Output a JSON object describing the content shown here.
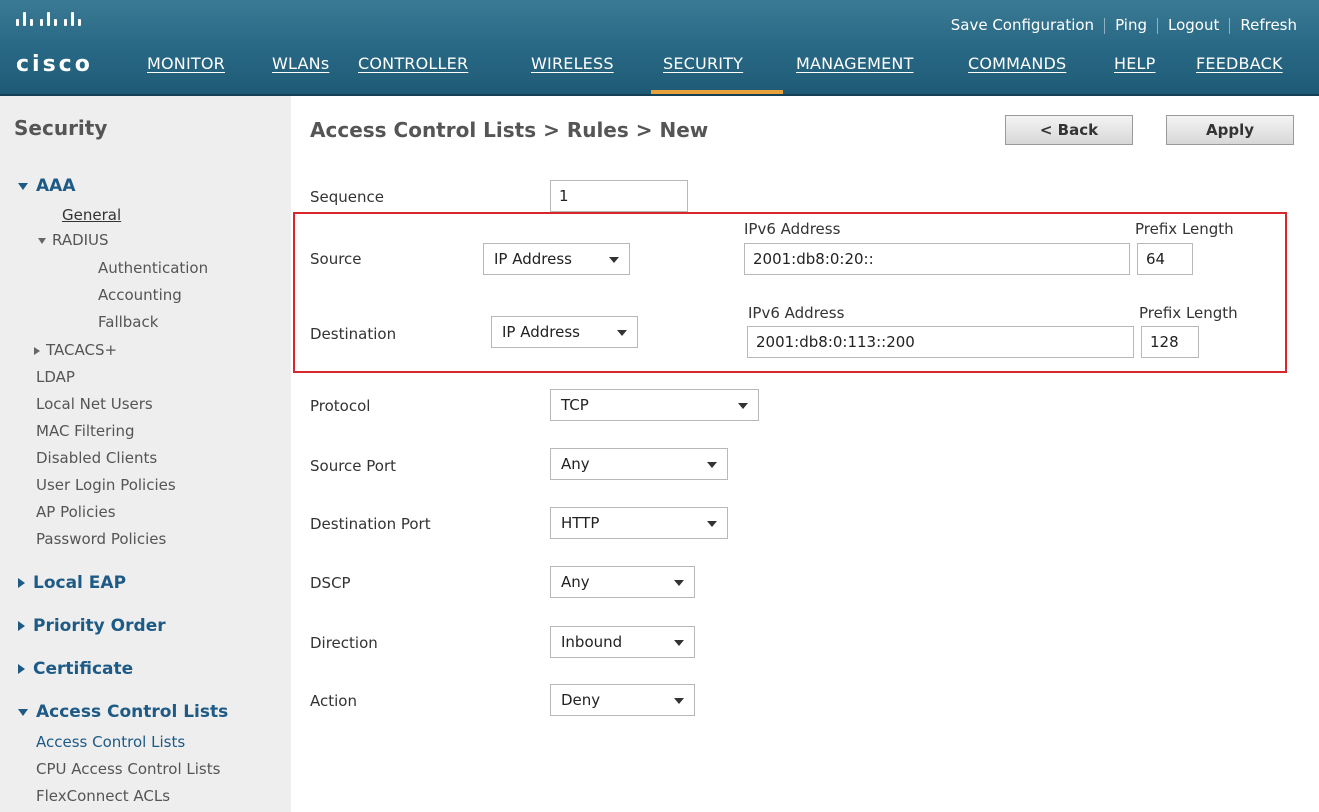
{
  "header": {
    "logo": "cisco",
    "util_links": [
      "Save Configuration",
      "Ping",
      "Logout",
      "Refresh"
    ],
    "nav": [
      "MONITOR",
      "WLANs",
      "CONTROLLER",
      "WIRELESS",
      "SECURITY",
      "MANAGEMENT",
      "COMMANDS",
      "HELP",
      "FEEDBACK"
    ],
    "active_nav": "SECURITY",
    "accent": "#e7a23c"
  },
  "sidebar": {
    "title": "Security",
    "aaa": "AAA",
    "general": "General",
    "radius": "RADIUS",
    "authentication": "Authentication",
    "accounting": "Accounting",
    "fallback": "Fallback",
    "tacacs": "TACACS+",
    "ldap": "LDAP",
    "local_net_users": "Local Net Users",
    "mac_filtering": "MAC Filtering",
    "disabled_clients": "Disabled Clients",
    "user_login_policies": "User Login Policies",
    "ap_policies": "AP Policies",
    "password_policies": "Password Policies",
    "local_eap": "Local EAP",
    "priority_order": "Priority Order",
    "certificate": "Certificate",
    "acl": "Access Control Lists",
    "acl_sub": "Access Control Lists",
    "cpu_acl": "CPU Access Control Lists",
    "flexconnect": "FlexConnect ACLs"
  },
  "main": {
    "title": "Access Control Lists > Rules > New",
    "back_label": "< Back",
    "apply_label": "Apply",
    "sequence_label": "Sequence",
    "sequence_value": "1",
    "source_label": "Source",
    "source_type": "IP Address",
    "ipv6_label": "IPv6 Address",
    "prefix_label": "Prefix Length",
    "source_ipv6": "2001:db8:0:20::",
    "source_prefix": "64",
    "destination_label": "Destination",
    "destination_type": "IP Address",
    "destination_ipv6": "2001:db8:0:113::200",
    "destination_prefix": "128",
    "protocol_label": "Protocol",
    "protocol_value": "TCP",
    "source_port_label": "Source Port",
    "source_port_value": "Any",
    "dest_port_label": "Destination Port",
    "dest_port_value": "HTTP",
    "dscp_label": "DSCP",
    "dscp_value": "Any",
    "direction_label": "Direction",
    "direction_value": "Inbound",
    "action_label": "Action",
    "action_value": "Deny",
    "highlight_color": "#d9262c"
  }
}
